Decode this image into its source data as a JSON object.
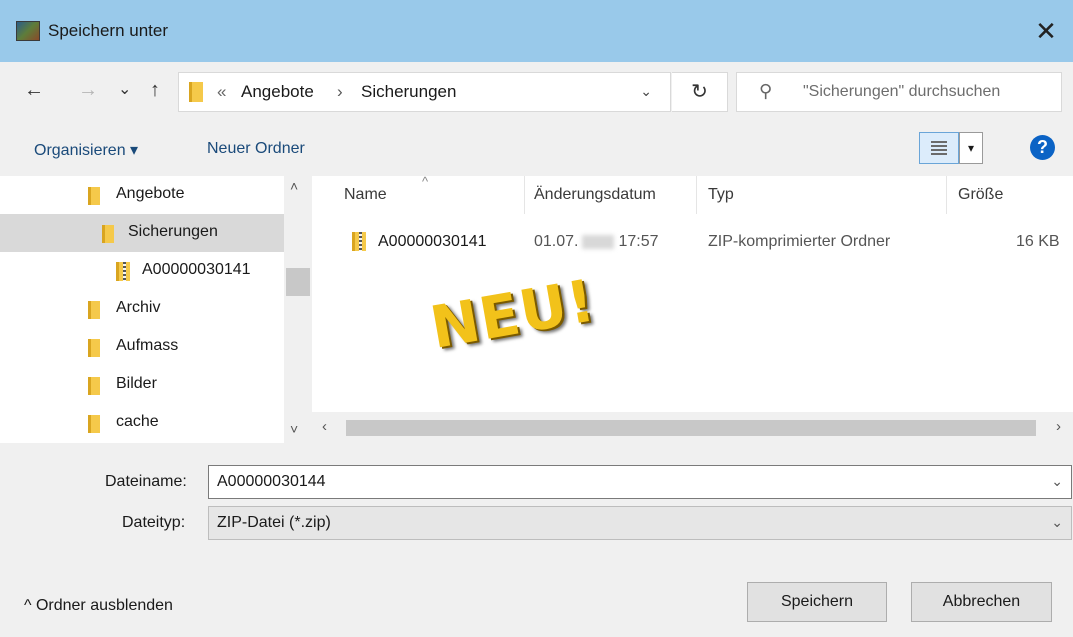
{
  "window": {
    "title": "Speichern unter",
    "close_glyph": "✕"
  },
  "nav": {
    "back": "←",
    "forward": "→",
    "recent": "⌄",
    "up": "↑",
    "breadcrumb_overflow": "«",
    "breadcrumb": [
      "Angebote",
      "Sicherungen"
    ],
    "breadcrumb_sep": "›",
    "dropdown": "⌄",
    "refresh": "↻",
    "search_placeholder": "\"Sicherungen\" durchsuchen"
  },
  "toolbar": {
    "organize": "Organisieren ▾",
    "new_folder": "Neuer Ordner",
    "view_dropdown": "▾",
    "help": "?"
  },
  "tree": {
    "items": [
      {
        "label": "Angebote",
        "type": "folder",
        "indent": 1,
        "selected": false
      },
      {
        "label": "Sicherungen",
        "type": "folder",
        "indent": 2,
        "selected": true
      },
      {
        "label": "A00000030141",
        "type": "zip",
        "indent": 3,
        "selected": false
      },
      {
        "label": "Archiv",
        "type": "folder",
        "indent": 1,
        "selected": false
      },
      {
        "label": "Aufmass",
        "type": "folder",
        "indent": 1,
        "selected": false
      },
      {
        "label": "Bilder",
        "type": "folder",
        "indent": 1,
        "selected": false
      },
      {
        "label": "cache",
        "type": "folder",
        "indent": 1,
        "selected": false
      }
    ],
    "scroll_up": "˄",
    "scroll_down": "˅"
  },
  "files": {
    "columns": {
      "name": "Name",
      "date": "Änderungsdatum",
      "type": "Typ",
      "size": "Größe"
    },
    "sort_indicator": "^",
    "rows": [
      {
        "name": "A00000030141",
        "date_prefix": "01.07.",
        "time": "17:57",
        "type": "ZIP-komprimierter Ordner",
        "size": "16 KB"
      }
    ],
    "overlay_text": "NEU!",
    "scroll_left": "‹",
    "scroll_right": "›"
  },
  "form": {
    "filename_label": "Dateiname:",
    "filename_value": "A00000030144",
    "filetype_label": "Dateityp:",
    "filetype_value": "ZIP-Datei (*.zip)",
    "dropdown": "⌄"
  },
  "footer": {
    "collapse_label": "^  Ordner ausblenden",
    "save_button": "Speichern",
    "cancel_button": "Abbrechen"
  },
  "colors": {
    "titlebar": "#99c9ea",
    "folder": "#f5c94a",
    "help": "#0b63c5",
    "overlay": "#f2c21a"
  }
}
